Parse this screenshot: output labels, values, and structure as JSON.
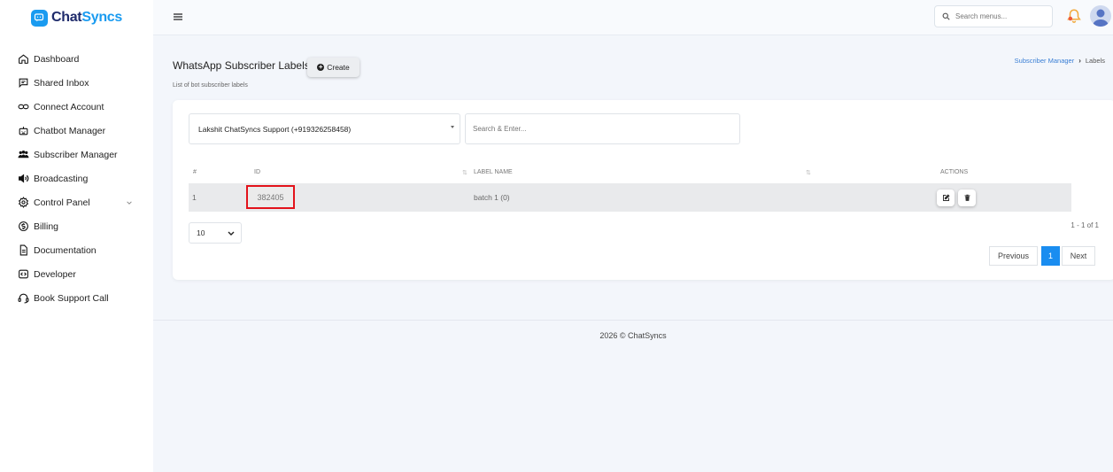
{
  "brand": {
    "name_part1": "Chat",
    "name_part2": "Syncs"
  },
  "sidebar": {
    "items": [
      {
        "label": "Dashboard",
        "icon": "home-icon"
      },
      {
        "label": "Shared Inbox",
        "icon": "inbox-icon"
      },
      {
        "label": "Connect Account",
        "icon": "link-icon"
      },
      {
        "label": "Chatbot Manager",
        "icon": "robot-icon"
      },
      {
        "label": "Subscriber Manager",
        "icon": "users-icon"
      },
      {
        "label": "Broadcasting",
        "icon": "speaker-icon"
      },
      {
        "label": "Control Panel",
        "icon": "gear-icon"
      },
      {
        "label": "Billing",
        "icon": "billing-icon"
      },
      {
        "label": "Documentation",
        "icon": "document-icon"
      },
      {
        "label": "Developer",
        "icon": "code-icon"
      },
      {
        "label": "Book Support Call",
        "icon": "headset-icon"
      }
    ]
  },
  "topbar": {
    "search_placeholder": "Search menus..."
  },
  "page": {
    "title": "WhatsApp Subscriber Labels",
    "create_label": "Create",
    "subtitle": "List of bot subscriber labels"
  },
  "breadcrumb": {
    "parent": "Subscriber Manager",
    "current": "Labels"
  },
  "filters": {
    "bot_selected": "Lakshit ChatSyncs Support (+919326258458)",
    "search_placeholder": "Search & Enter..."
  },
  "table": {
    "columns": [
      "#",
      "ID",
      "LABEL NAME",
      "ACTIONS"
    ],
    "rows": [
      {
        "num": "1",
        "id": "382405",
        "label_name": "batch 1 (0)"
      }
    ]
  },
  "pagination": {
    "per_page": "10",
    "info": "1 - 1 of 1",
    "previous": "Previous",
    "current_page": "1",
    "next": "Next"
  },
  "footer": {
    "text": "2026 © ChatSyncs"
  },
  "colors": {
    "accent": "#1a8df0",
    "highlight_border": "#e3131b",
    "brand_dark": "#1f2b6b"
  }
}
